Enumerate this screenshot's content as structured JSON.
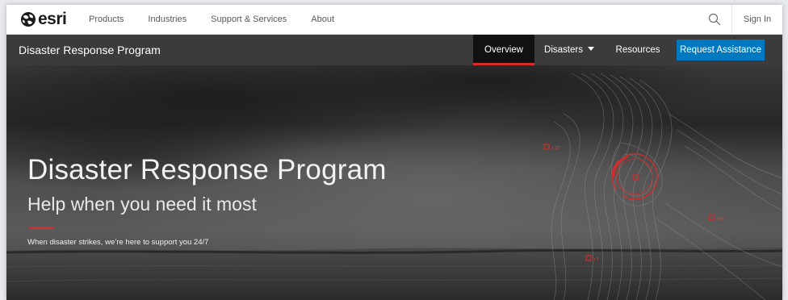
{
  "brand": {
    "logo_text": "esri",
    "logo_icon": "globe-icon"
  },
  "topnav": {
    "links": [
      "Products",
      "Industries",
      "Support & Services",
      "About"
    ],
    "search_icon": "search-icon",
    "signin_label": "Sign In"
  },
  "subnav": {
    "title": "Disaster Response Program",
    "tabs": {
      "overview": "Overview",
      "disasters": "Disasters",
      "resources": "Resources"
    },
    "request_label": "Request Assistance"
  },
  "hero": {
    "title": "Disaster Response Program",
    "subtitle": "Help when you need it most",
    "tagline": "When disaster strikes, we’re here to support you 24/7"
  },
  "colors": {
    "accent_red": "#d62b2b",
    "button_blue": "#0079c1",
    "subnav_bg": "#3b3b3b",
    "active_tab_bg": "#111111"
  }
}
